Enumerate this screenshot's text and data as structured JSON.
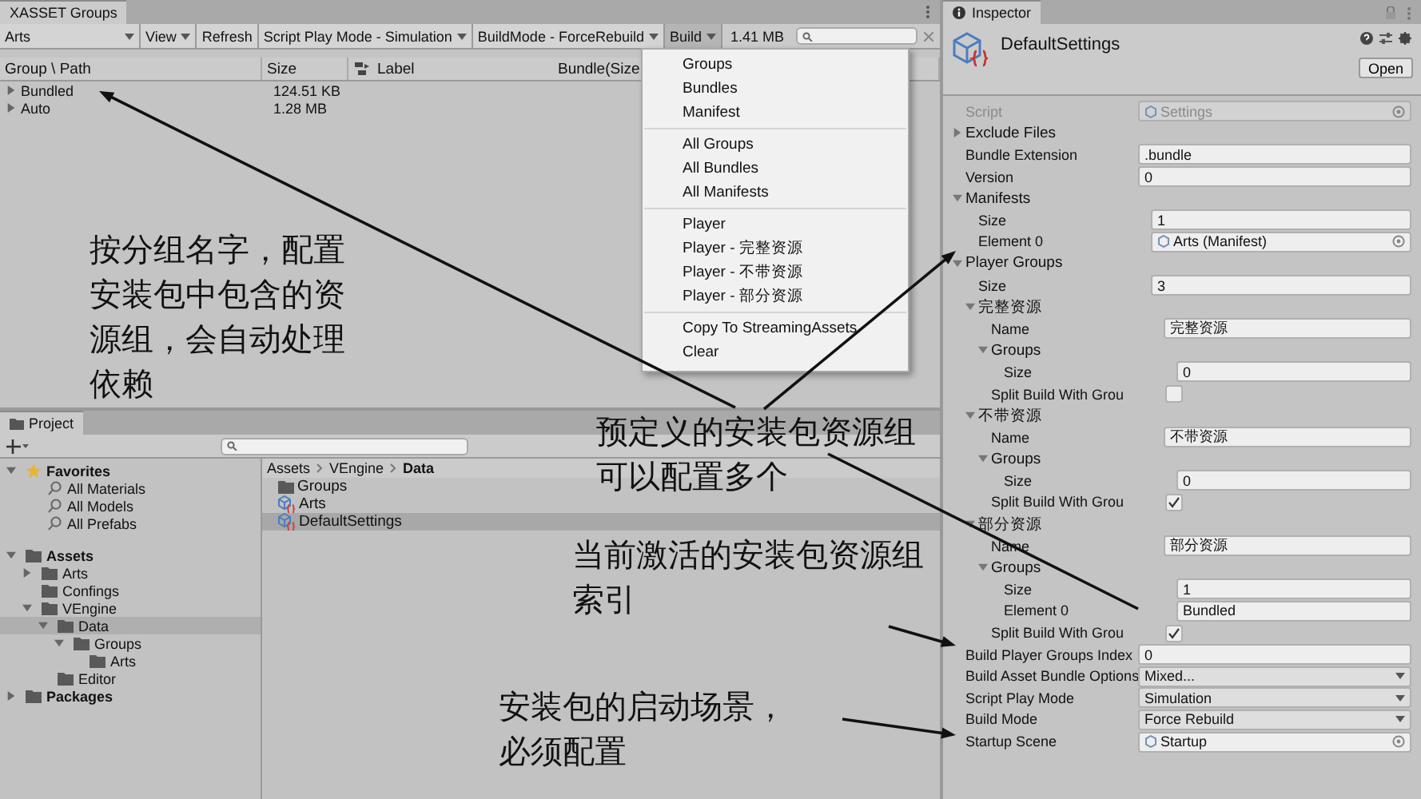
{
  "groups_window": {
    "tab": "XASSET Groups",
    "toolbar": [
      {
        "kind": "dropdown",
        "label": "Arts",
        "pressed": false
      },
      {
        "kind": "dropdown",
        "label": "View",
        "pressed": false
      },
      {
        "kind": "button",
        "label": "Refresh",
        "pressed": false
      },
      {
        "kind": "dropdown",
        "label": "Script Play Mode - Simulation",
        "pressed": false
      },
      {
        "kind": "dropdown",
        "label": "BuildMode - ForceRebuild",
        "pressed": false
      },
      {
        "kind": "dropdown",
        "label": "Build",
        "pressed": true
      }
    ],
    "total_size": "1.41 MB",
    "columns": [
      "Group \\ Path",
      "Size",
      "Label",
      "Bundle(Size"
    ],
    "rows": [
      {
        "name": "Bundled",
        "size": "124.51 KB",
        "expanded": false
      },
      {
        "name": "Auto",
        "size": "1.28 MB",
        "expanded": false
      }
    ]
  },
  "build_menu": {
    "sections": [
      [
        "Groups",
        "Bundles",
        "Manifest"
      ],
      [
        "All Groups",
        "All Bundles",
        "All Manifests"
      ],
      [
        "Player",
        "Player - 完整资源",
        "Player - 不带资源",
        "Player - 部分资源"
      ],
      [
        "Copy To StreamingAssets",
        "Clear"
      ]
    ]
  },
  "project": {
    "tab": "Project",
    "favorites": {
      "label": "Favorites",
      "expanded": true,
      "searches": [
        "All Materials",
        "All Models",
        "All Prefabs"
      ]
    },
    "tree": [
      {
        "label": "Assets",
        "expanded": true,
        "selected": false,
        "children": [
          {
            "label": "Arts",
            "expanded": false,
            "selected": false
          },
          {
            "label": "Confings",
            "selected": false
          },
          {
            "label": "VEngine",
            "expanded": true,
            "selected": false,
            "children": [
              {
                "label": "Data",
                "expanded": true,
                "selected": true,
                "children": [
                  {
                    "label": "Groups",
                    "expanded": true,
                    "selected": false,
                    "children": [
                      {
                        "label": "Arts",
                        "selected": false
                      }
                    ]
                  }
                ]
              },
              {
                "label": "Editor",
                "selected": false
              }
            ]
          }
        ]
      },
      {
        "label": "Packages",
        "expanded": false,
        "selected": false
      }
    ],
    "breadcrumb": [
      "Assets",
      "VEngine",
      "Data"
    ],
    "files": [
      {
        "name": "Groups",
        "kind": "folder",
        "selected": false
      },
      {
        "name": "Arts",
        "kind": "asset",
        "selected": false
      },
      {
        "name": "DefaultSettings",
        "kind": "asset",
        "selected": true
      }
    ]
  },
  "inspector": {
    "tab": "Inspector",
    "title": "DefaultSettings",
    "open_button": "Open",
    "properties": [
      {
        "kind": "object",
        "label": "Script",
        "value": "Settings",
        "disabled": true
      },
      {
        "kind": "foldout",
        "label": "Exclude Files",
        "expanded": false
      },
      {
        "kind": "field",
        "label": "Bundle Extension",
        "value": ".bundle"
      },
      {
        "kind": "field",
        "label": "Version",
        "value": "0"
      },
      {
        "kind": "foldout",
        "label": "Manifests",
        "expanded": true,
        "children": [
          {
            "kind": "field",
            "label": "Size",
            "value": "1"
          },
          {
            "kind": "object",
            "label": "Element 0",
            "value": "Arts (Manifest)",
            "disabled": false
          }
        ]
      },
      {
        "kind": "foldout",
        "label": "Player Groups",
        "expanded": true,
        "children": [
          {
            "kind": "field",
            "label": "Size",
            "value": "3"
          },
          {
            "kind": "foldout",
            "label": "完整资源",
            "expanded": true,
            "children": [
              {
                "kind": "field",
                "label": "Name",
                "value": "完整资源"
              },
              {
                "kind": "foldout",
                "label": "Groups",
                "expanded": true,
                "children": [
                  {
                    "kind": "field",
                    "label": "Size",
                    "value": "0"
                  }
                ]
              },
              {
                "kind": "checkbox",
                "label": "Split Build With Grou",
                "checked": false
              }
            ]
          },
          {
            "kind": "foldout",
            "label": "不带资源",
            "expanded": true,
            "children": [
              {
                "kind": "field",
                "label": "Name",
                "value": "不带资源"
              },
              {
                "kind": "foldout",
                "label": "Groups",
                "expanded": true,
                "children": [
                  {
                    "kind": "field",
                    "label": "Size",
                    "value": "0"
                  }
                ]
              },
              {
                "kind": "checkbox",
                "label": "Split Build With Grou",
                "checked": true
              }
            ]
          },
          {
            "kind": "foldout",
            "label": "部分资源",
            "expanded": true,
            "children": [
              {
                "kind": "field",
                "label": "Name",
                "value": "部分资源"
              },
              {
                "kind": "foldout",
                "label": "Groups",
                "expanded": true,
                "children": [
                  {
                    "kind": "field",
                    "label": "Size",
                    "value": "1"
                  },
                  {
                    "kind": "field",
                    "label": "Element 0",
                    "value": "Bundled"
                  }
                ]
              },
              {
                "kind": "checkbox",
                "label": "Split Build With Grou",
                "checked": true
              }
            ]
          }
        ]
      },
      {
        "kind": "field",
        "label": "Build Player Groups Index",
        "value": "0"
      },
      {
        "kind": "dropdown",
        "label": "Build Asset Bundle Options",
        "value": "Mixed..."
      },
      {
        "kind": "dropdown",
        "label": "Script Play Mode",
        "value": "Simulation"
      },
      {
        "kind": "dropdown",
        "label": "Build Mode",
        "value": "Force Rebuild"
      },
      {
        "kind": "object",
        "label": "Startup Scene",
        "value": "Startup",
        "disabled": false
      }
    ]
  },
  "annotations": [
    "按分组名字，配置安装包中包含的资源组，会自动处理依赖",
    "预定义的安装包资源组可以配置多个",
    "当前激活的安装包资源组索引",
    "安装包的启动场景，必须配置"
  ]
}
